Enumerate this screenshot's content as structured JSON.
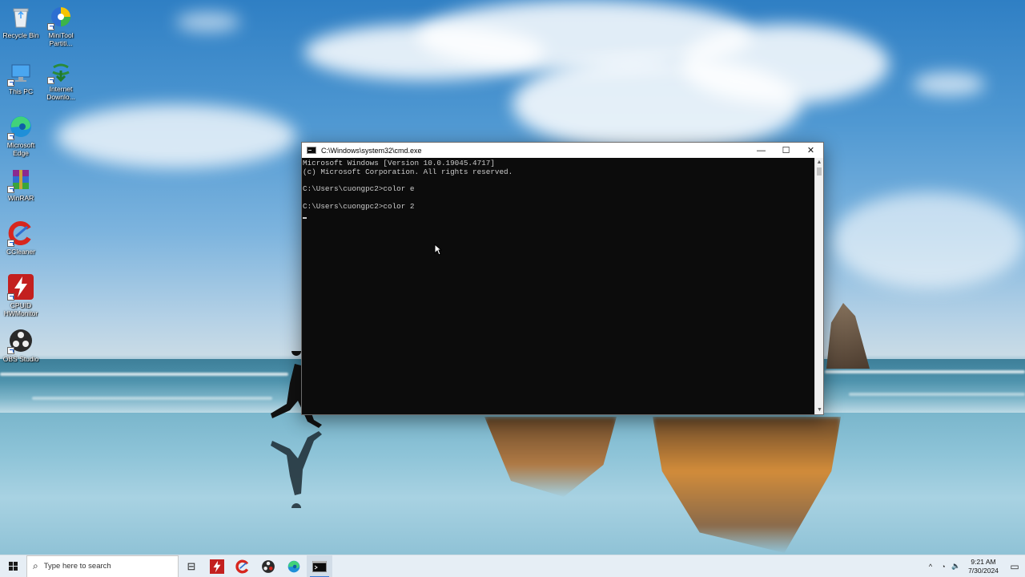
{
  "desktop": {
    "icons": [
      {
        "id": "recycle-bin",
        "label": "Recycle Bin",
        "icon": "recycle-bin-icon"
      },
      {
        "id": "minitool",
        "label": "MiniTool Partiti...",
        "icon": "minitool-icon"
      },
      {
        "id": "this-pc",
        "label": "This PC",
        "icon": "computer-icon"
      },
      {
        "id": "idm",
        "label": "Internet Downlo...",
        "icon": "idm-globe-icon"
      },
      {
        "id": "edge",
        "label": "Microsoft Edge",
        "icon": "edge-icon"
      },
      {
        "id": "winrar",
        "label": "WinRAR",
        "icon": "winrar-icon"
      },
      {
        "id": "ccleaner",
        "label": "CCleaner",
        "icon": "ccleaner-icon"
      },
      {
        "id": "hwmonitor",
        "label": "CPUID HWMonitor",
        "icon": "hwmonitor-icon"
      },
      {
        "id": "obs",
        "label": "OBS Studio",
        "icon": "obs-icon"
      }
    ]
  },
  "cmd": {
    "title": "C:\\Windows\\system32\\cmd.exe",
    "lines": [
      "Microsoft Windows [Version 10.0.19045.4717]",
      "(c) Microsoft Corporation. All rights reserved.",
      "",
      "C:\\Users\\cuongpc2>color e",
      "",
      "C:\\Users\\cuongpc2>color 2"
    ],
    "minimize_glyph": "—",
    "maximize_glyph": "☐",
    "close_glyph": "✕",
    "scroll_up_glyph": "▲",
    "scroll_down_glyph": "▼",
    "colors": {
      "background": "#0c0c0c",
      "text": "#cccccc"
    }
  },
  "taskbar": {
    "search_placeholder": "Type here to search",
    "search_icon_glyph": "⌕",
    "task_view_glyph": "⊟",
    "apps": [
      {
        "name": "hwmonitor",
        "icon": "hwmonitor-icon"
      },
      {
        "name": "ccleaner",
        "icon": "ccleaner-icon"
      },
      {
        "name": "obs",
        "icon": "obs-icon"
      },
      {
        "name": "edge",
        "icon": "edge-icon"
      },
      {
        "name": "cmd",
        "icon": "cmd-icon",
        "active": true
      }
    ],
    "tray": {
      "chevron_glyph": "^",
      "network_glyph": "◔",
      "volume_glyph": "🔈",
      "time": "9:21 AM",
      "date": "7/30/2024",
      "notification_glyph": "▭"
    }
  }
}
